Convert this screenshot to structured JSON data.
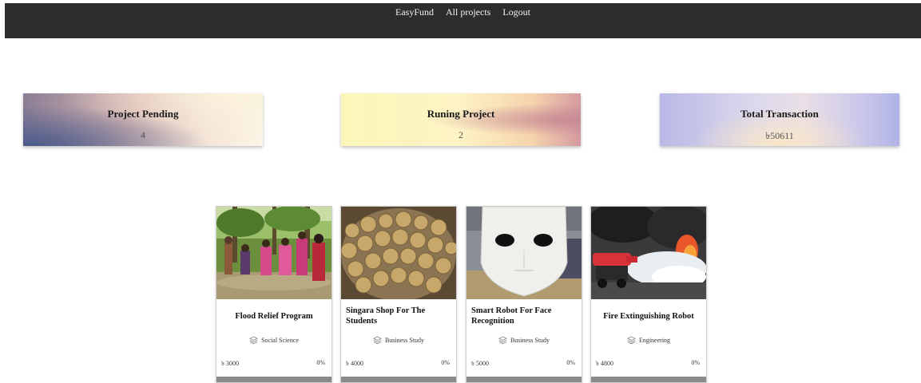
{
  "nav": {
    "brand": "EasyFund",
    "all_projects": "All projects",
    "logout": "Logout"
  },
  "stats": [
    {
      "title": "Project Pending",
      "value": "4"
    },
    {
      "title": "Runing Project",
      "value": "2"
    },
    {
      "title": "Total Transaction",
      "value": "৳50611"
    }
  ],
  "projects": [
    {
      "title": "Flood Relief Program",
      "category": "Social Science",
      "amount": "৳ 3000",
      "progress": "0%",
      "image": "flood-relief-photo"
    },
    {
      "title": "Singara Shop For The Students",
      "category": "Business Study",
      "amount": "৳ 4000",
      "progress": "0%",
      "image": "singara-photo"
    },
    {
      "title": "Smart Robot For Face Recognition",
      "category": "Business Study",
      "amount": "৳ 5000",
      "progress": "0%",
      "image": "robot-face-photo"
    },
    {
      "title": "Fire Extinguishing Robot",
      "category": "Engineering",
      "amount": "৳ 4800",
      "progress": "0%",
      "image": "fire-robot-photo"
    }
  ],
  "icons": {
    "category": "layers-icon"
  },
  "colors": {
    "navbar": "#2d2d2d",
    "progress_bar": "#8a8a8a"
  }
}
